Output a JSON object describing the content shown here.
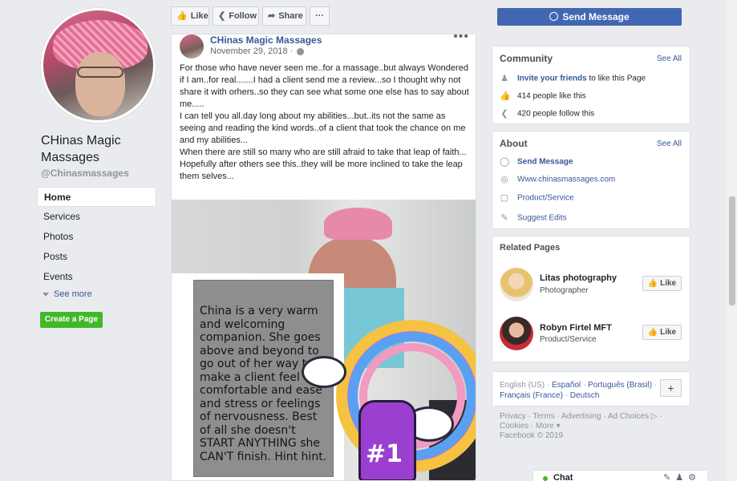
{
  "page": {
    "name": "CHinas Magic Massages",
    "handle": "@Chinasmassages"
  },
  "left_nav": {
    "items": [
      "Home",
      "Services",
      "Photos",
      "Posts",
      "Events"
    ],
    "see_more": "See more",
    "create_page": "Create a Page"
  },
  "actions": {
    "like": "Like",
    "follow": "Follow",
    "share": "Share",
    "more": "···",
    "send_message": "Send Message"
  },
  "post": {
    "author": "CHinas Magic Massages",
    "date": "November 29, 2018 ·",
    "menu": "•••",
    "lines": [
      "For those who have never seen me..for a massage..but always Wondered if I am..for real.......I had a client send me a review...so I thought why not share it with orhers..so they can see what some one else has to say about me.....",
      "I can tell you all.day long about my abilities...but..its not the same as seeing and reading the kind words..of a client that took the chance on me and my abilities...",
      "When there are still so many who are still afraid to take that leap of faith...",
      "Hopefully after others see this..they will be more inclined to take the leap them selves..."
    ],
    "photo_quote": "China is a very warm and welcoming companion. She goes above and beyond to go out of her way to make a client feel comfortable and ease and stress or feelings of nervousness. Best of all she doesn't START ANYTHING she CAN'T finish. Hint hint.",
    "photo_sticker": "#1"
  },
  "community": {
    "title": "Community",
    "see_all": "See All",
    "invite_link": "Invite your friends",
    "invite_rest": " to like this Page",
    "likes": "414 people like this",
    "follows": "420 people follow this"
  },
  "about": {
    "title": "About",
    "see_all": "See All",
    "send_message": "Send Message",
    "website": "Www.chinasmassages.com",
    "category": "Product/Service",
    "suggest": "Suggest Edits"
  },
  "related": {
    "title": "Related Pages",
    "pages": [
      {
        "name": "Litas photography",
        "sub": "Photographer",
        "like": "Like"
      },
      {
        "name": "Robyn Firtel MFT",
        "sub": "Product/Service",
        "like": "Like"
      }
    ]
  },
  "languages": {
    "current": "English (US) · ",
    "links": [
      "Español",
      "Português (Brasil)",
      "Français (France)",
      "Deutsch"
    ],
    "plus": "+"
  },
  "footer": {
    "line1": "Privacy · Terms · Advertising · Ad Choices ▷ ·",
    "line2": "Cookies · More ▾",
    "line3": "Facebook © 2019"
  },
  "chat": {
    "label": "Chat"
  },
  "colors": {
    "brand_blue": "#4267b2",
    "link_blue": "#365899",
    "green": "#42b72a",
    "background": "#e9ebee"
  }
}
